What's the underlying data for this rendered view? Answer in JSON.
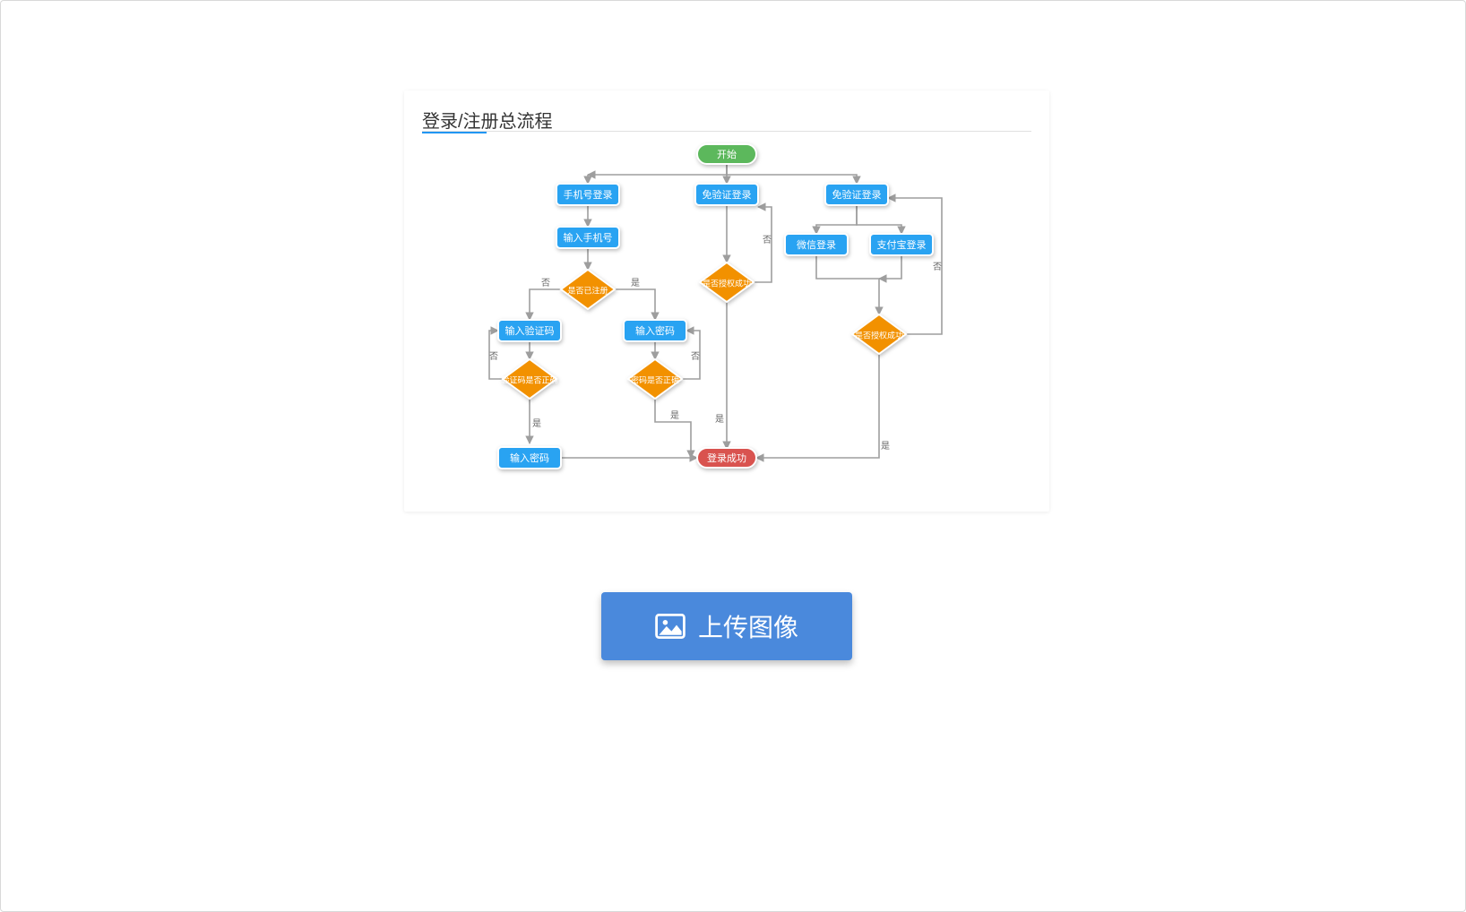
{
  "diagram": {
    "title": "登录/注册总流程",
    "nodes": {
      "start": "开始",
      "phone_login": "手机号登录",
      "face_login_a": "免验证登录",
      "face_login_b": "免验证登录",
      "enter_phone": "输入手机号",
      "registered": "是否已注册",
      "auth_ok_1": "是否授权成功",
      "wechat_login": "微信登录",
      "alipay_login": "支付宝登录",
      "auth_ok_2": "是否授权成功",
      "enter_code": "输入验证码",
      "enter_pwd_1": "输入密码",
      "code_ok": "验证码是否正确",
      "pwd_ok": "密码是否正确",
      "enter_pwd_2": "输入密码",
      "success": "登录成功"
    },
    "edge_labels": {
      "yes": "是",
      "no": "否"
    }
  },
  "upload_button": {
    "label": "上传图像"
  }
}
